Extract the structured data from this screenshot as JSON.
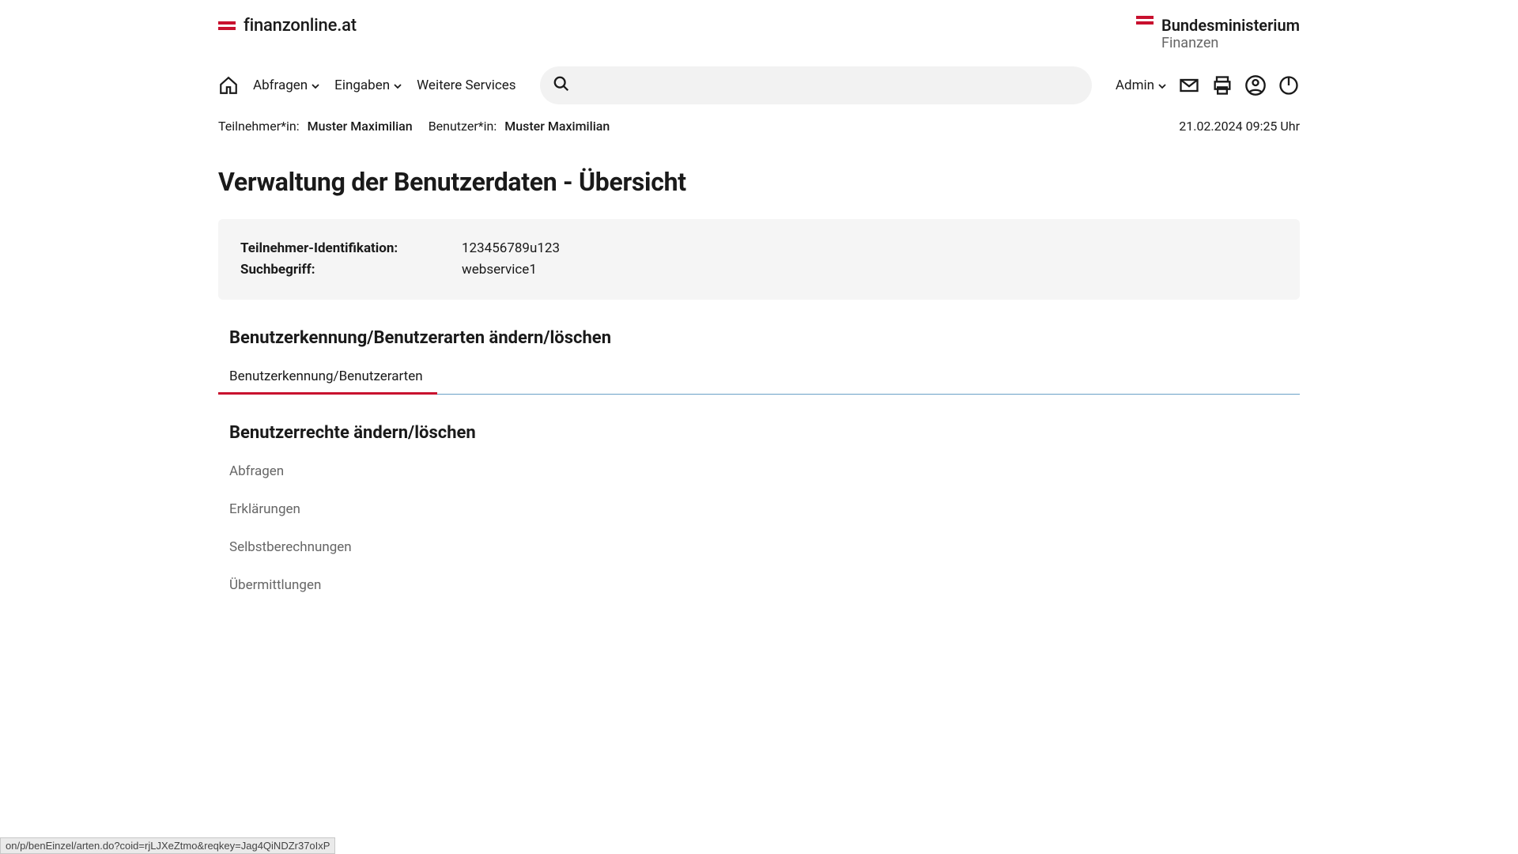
{
  "header": {
    "site_name": "finanzonline.at",
    "ministry_line1": "Bundesministerium",
    "ministry_line2": "Finanzen"
  },
  "nav": {
    "abfragen": "Abfragen",
    "eingaben": "Eingaben",
    "weitere": "Weitere Services",
    "admin": "Admin"
  },
  "meta": {
    "teilnehmer_label": "Teilnehmer*in:",
    "teilnehmer_value": "Muster Maximilian",
    "benutzer_label": "Benutzer*in:",
    "benutzer_value": "Muster Maximilian",
    "timestamp": "21.02.2024 09:25 Uhr"
  },
  "page_title": "Verwaltung der Benutzerdaten - Übersicht",
  "info": {
    "id_label": "Teilnehmer-Identifikation:",
    "id_value": "123456789u123",
    "such_label": "Suchbegriff:",
    "such_value": "webservice1"
  },
  "section1": {
    "title": "Benutzerkennung/Benutzerarten ändern/löschen",
    "tab": "Benutzerkennung/Benutzerarten"
  },
  "section2": {
    "title": "Benutzerrechte ändern/löschen",
    "items": {
      "0": "Abfragen",
      "1": "Erklärungen",
      "2": "Selbstberechnungen",
      "3": "Übermittlungen"
    }
  },
  "statusbar": "on/p/benEinzel/arten.do?coid=rjLJXeZtmo&reqkey=Jag4QiNDZr37oIxP"
}
